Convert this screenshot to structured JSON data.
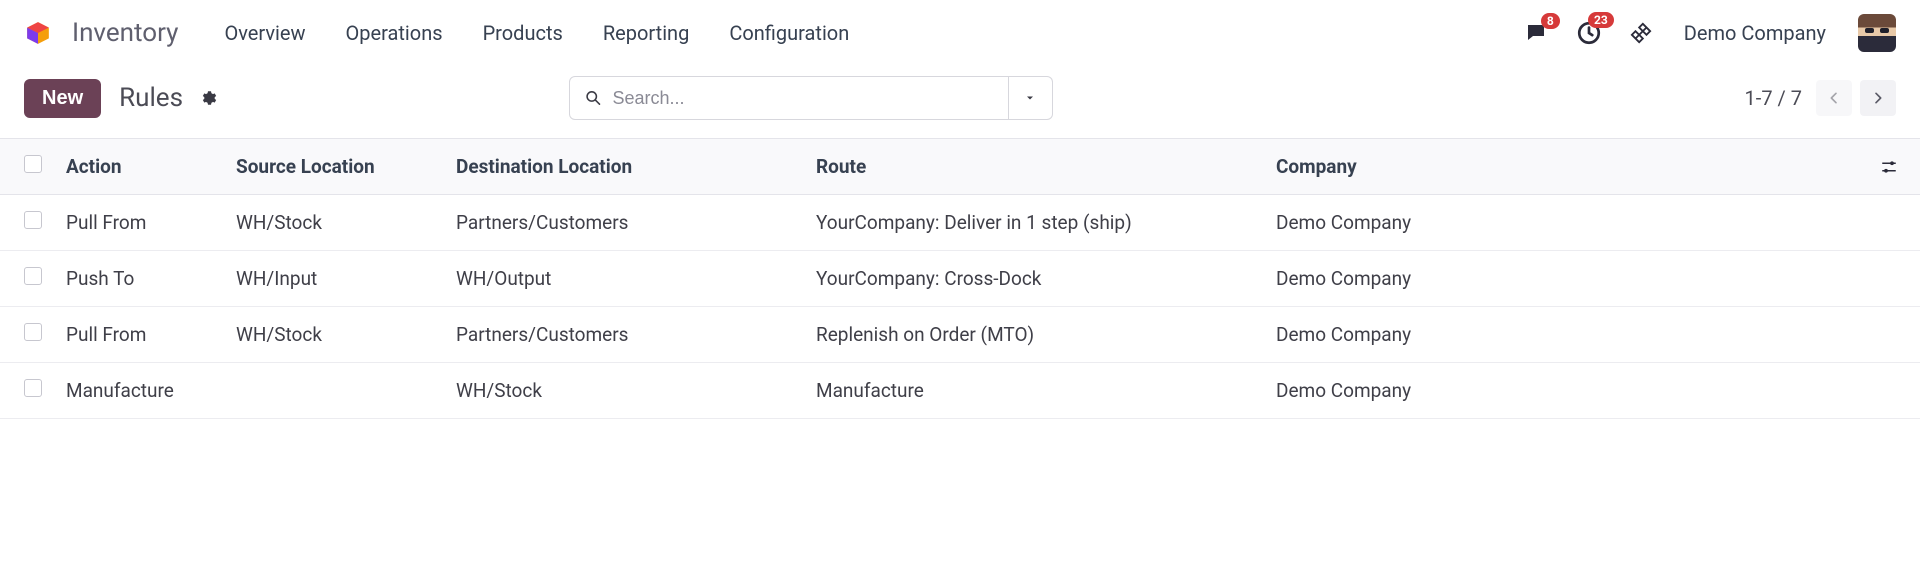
{
  "header": {
    "app_title": "Inventory",
    "nav": [
      "Overview",
      "Operations",
      "Products",
      "Reporting",
      "Configuration"
    ],
    "msg_badge": "8",
    "activity_badge": "23",
    "company": "Demo Company"
  },
  "toolbar": {
    "new_label": "New",
    "breadcrumb": "Rules",
    "search_placeholder": "Search...",
    "pager": "1-7 / 7"
  },
  "columns": {
    "action": "Action",
    "source": "Source Location",
    "destination": "Destination Location",
    "route": "Route",
    "company": "Company"
  },
  "rows": [
    {
      "action": "Pull From",
      "source": "WH/Stock",
      "destination": "Partners/Customers",
      "route": "YourCompany: Deliver in 1 step (ship)",
      "company": "Demo Company"
    },
    {
      "action": "Push To",
      "source": "WH/Input",
      "destination": "WH/Output",
      "route": "YourCompany: Cross-Dock",
      "company": "Demo Company"
    },
    {
      "action": "Pull From",
      "source": "WH/Stock",
      "destination": "Partners/Customers",
      "route": "Replenish on Order (MTO)",
      "company": "Demo Company"
    },
    {
      "action": "Manufacture",
      "source": "",
      "destination": "WH/Stock",
      "route": "Manufacture",
      "company": "Demo Company"
    }
  ]
}
